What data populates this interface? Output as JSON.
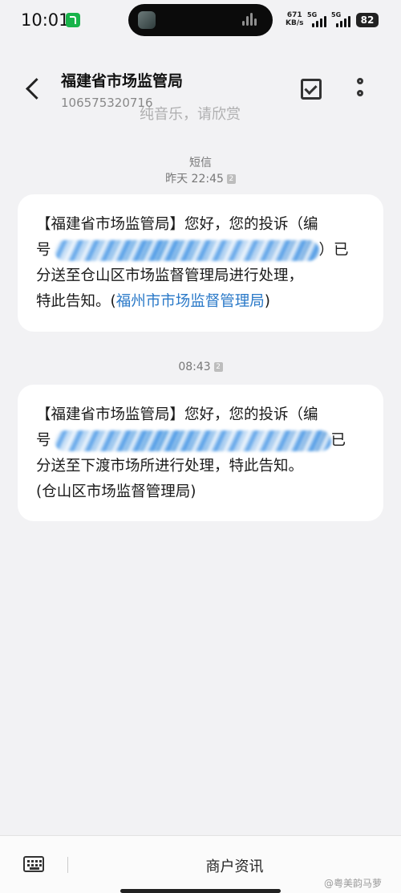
{
  "status_bar": {
    "time": "10:01",
    "net_speed_value": "671",
    "net_speed_unit": "KB/s",
    "sim1_label": "5G",
    "sim2_label": "5G",
    "battery": "82",
    "music_icon": "music-app-icon",
    "accent": "#18b34a"
  },
  "header": {
    "sender_name": "福建省市场监管局",
    "sender_number": "106575320716",
    "overlay_text": "纯音乐，请欣赏",
    "back_icon": "chevron-left-icon",
    "check_icon": "checkbox-icon",
    "more_icon": "more-vertical-icon"
  },
  "conversation": {
    "channel_label": "短信",
    "messages": [
      {
        "timestamp": "昨天 22:45",
        "sim_badge": "2",
        "line1": "【福建省市场监管局】您好，您的投诉（编",
        "line2_start": "号",
        "line2_end": "）已",
        "line3": "分送至仓山区市场监督管理局进行处理，",
        "line4_text": "特此告知。(",
        "line4_link": "福州市市场监督管理局",
        "line4_end": ")"
      },
      {
        "timestamp": "08:43",
        "sim_badge": "2",
        "line1": "【福建省市场监管局】您好，您的投诉（编",
        "line2_start": "号",
        "line2_end": "已",
        "line3": "分送至下渡市场所进行处理，特此告知。",
        "line4": "(仓山区市场监督管理局)"
      }
    ],
    "link_color": "#2a79c8"
  },
  "bottom_bar": {
    "keyboard_icon": "keyboard-icon",
    "merchant_info": "商户资讯",
    "watermark": "@粤美韵马萝"
  }
}
